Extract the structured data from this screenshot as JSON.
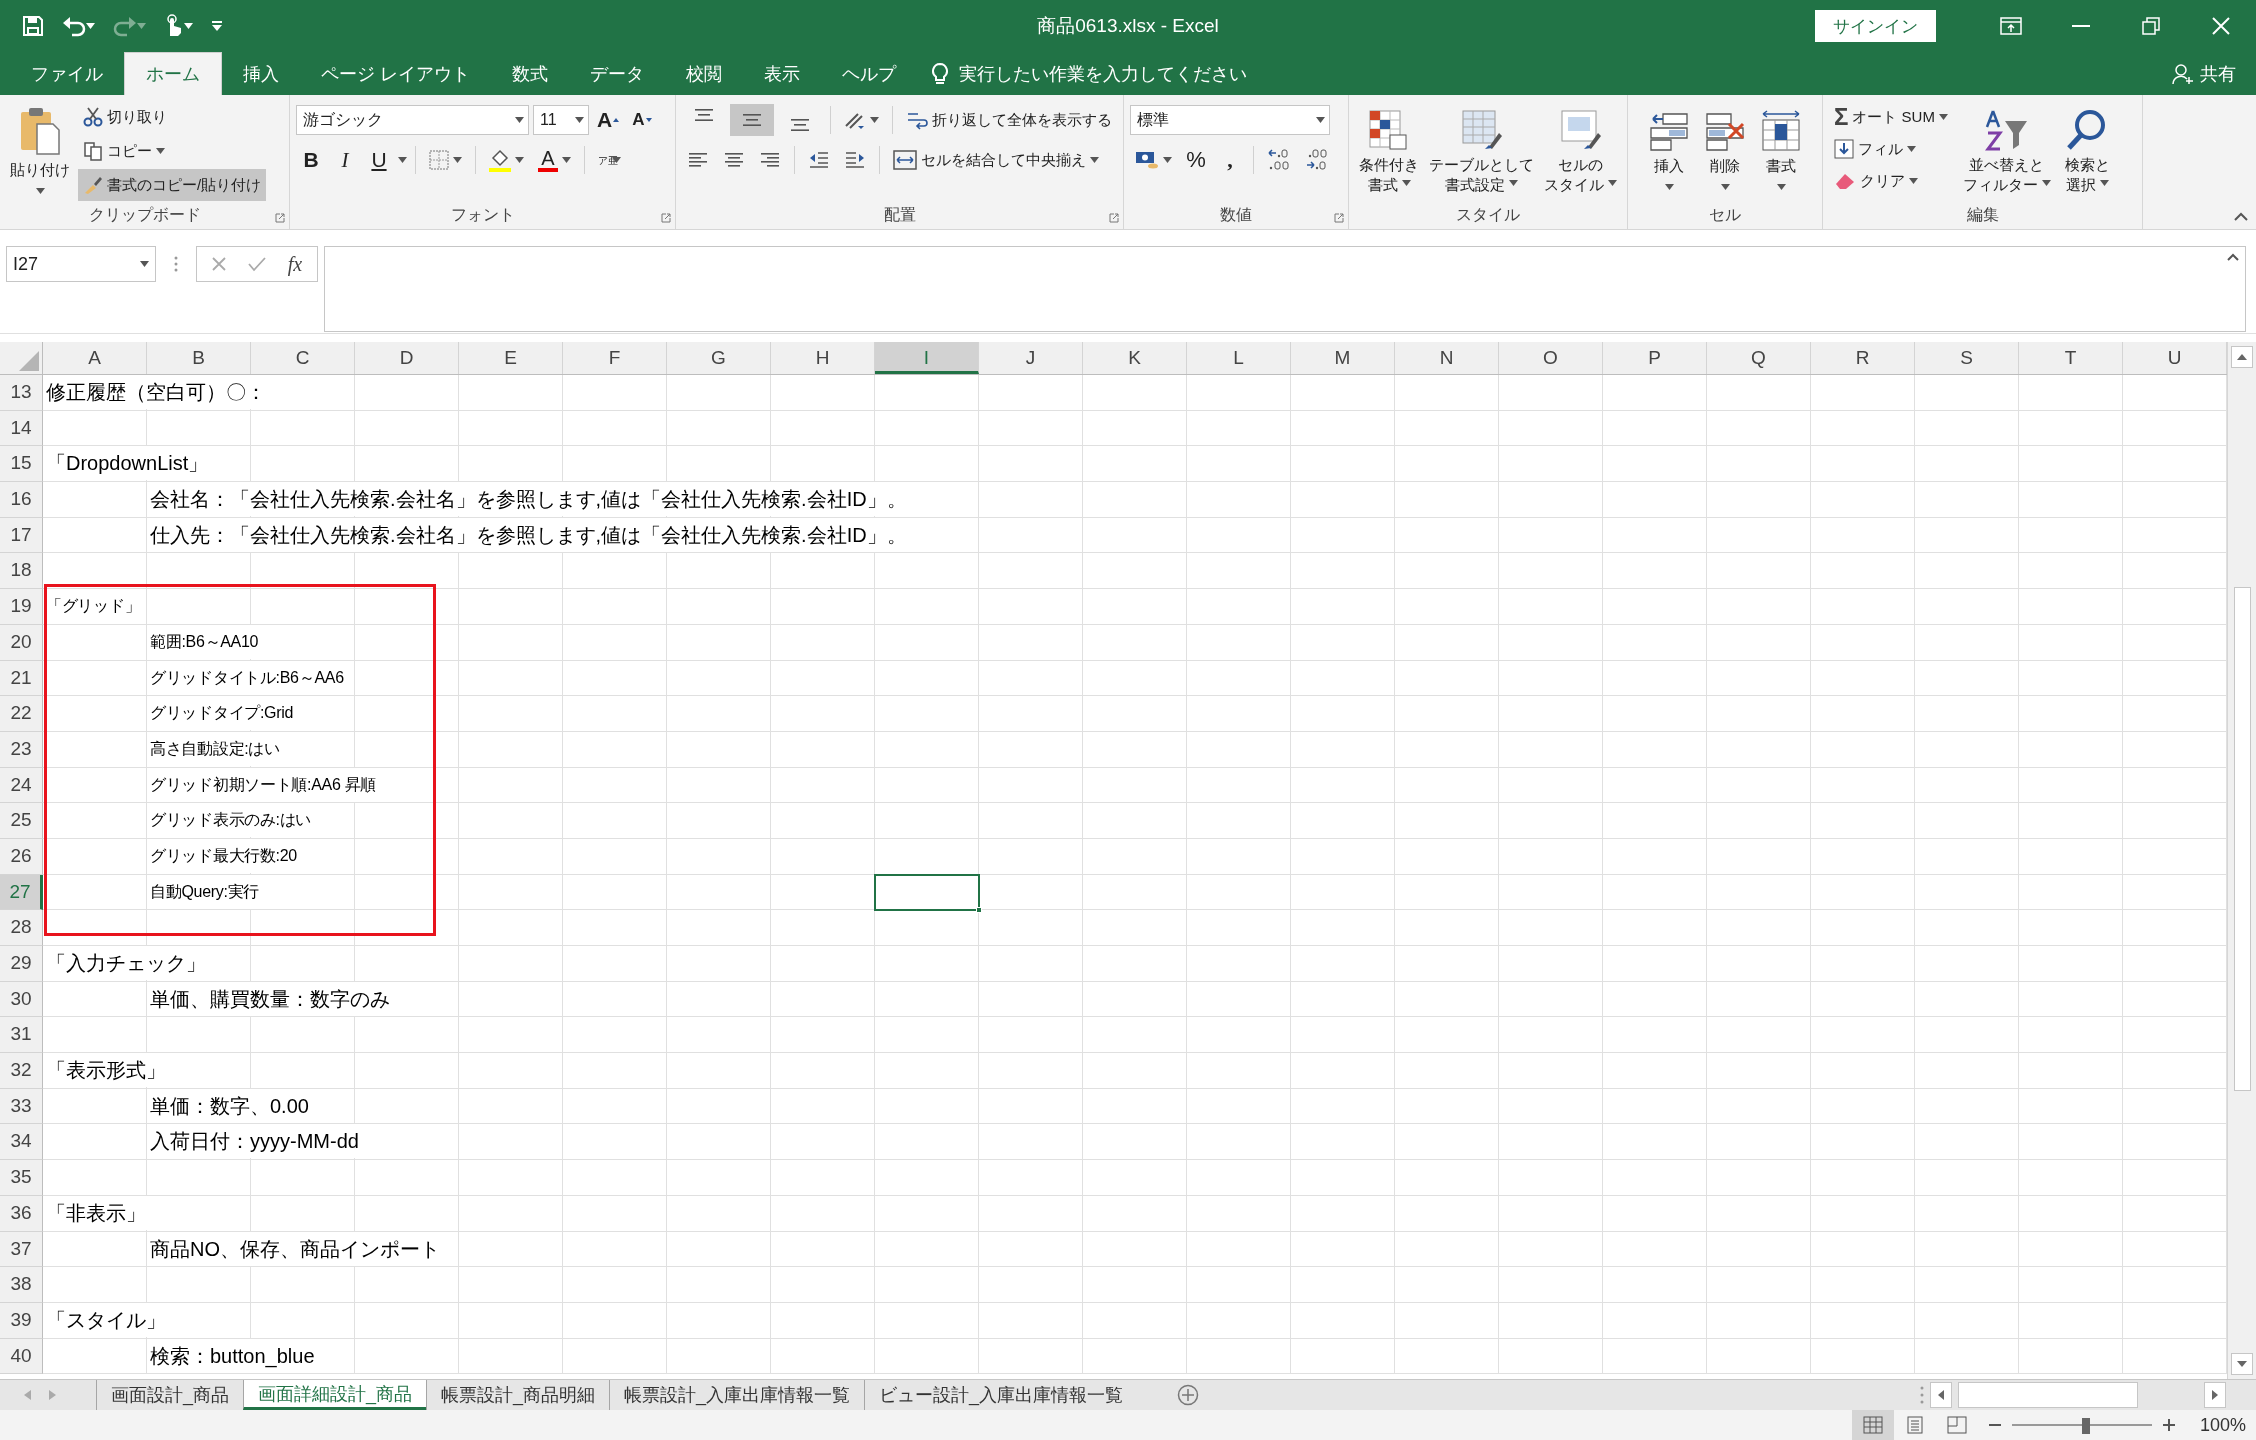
{
  "title_bar": {
    "title": "商品0613.xlsx  -  Excel",
    "sign_in": "サインイン"
  },
  "menu": {
    "tabs": [
      {
        "label": "ファイル",
        "selected": false
      },
      {
        "label": "ホーム",
        "selected": true
      },
      {
        "label": "挿入",
        "selected": false
      },
      {
        "label": "ページ レイアウト",
        "selected": false
      },
      {
        "label": "数式",
        "selected": false
      },
      {
        "label": "データ",
        "selected": false
      },
      {
        "label": "校閲",
        "selected": false
      },
      {
        "label": "表示",
        "selected": false
      },
      {
        "label": "ヘルプ",
        "selected": false
      }
    ],
    "tell_me": "実行したい作業を入力してください",
    "share": "共有"
  },
  "ribbon": {
    "clipboard": {
      "label": "クリップボード",
      "paste": "貼り付け",
      "cut": "切り取り",
      "copy": "コピー",
      "format_painter": {
        "label": "書式のコピー/貼り付け",
        "on": true
      }
    },
    "font": {
      "label": "フォント",
      "font_name": "游ゴシック",
      "font_size": "11",
      "grow": "A",
      "shrink": "A",
      "bold": "B",
      "italic": "I",
      "underline": "U",
      "font_color": "A",
      "phonetic": "ア亜"
    },
    "alignment": {
      "label": "配置",
      "vertical": [
        {
          "kind": "top",
          "on": false
        },
        {
          "kind": "middle",
          "on": true
        },
        {
          "kind": "bottom",
          "on": false
        }
      ],
      "wrap_text": "折り返して全体を表示する",
      "merge": "セルを結合して中央揃え"
    },
    "number": {
      "label": "数値",
      "format": "標準",
      "percent": "%",
      "comma": ","
    },
    "styles": {
      "label": "スタイル",
      "buttons": [
        {
          "kind": "conditional",
          "lines": [
            "条件付き",
            "書式"
          ]
        },
        {
          "kind": "table",
          "lines": [
            "テーブルとして",
            "書式設定"
          ]
        },
        {
          "kind": "cell_style",
          "lines": [
            "セルの",
            "スタイル"
          ]
        }
      ]
    },
    "cells": {
      "label": "セル",
      "buttons": [
        {
          "kind": "insert",
          "label": "挿入"
        },
        {
          "kind": "delete",
          "label": "削除"
        },
        {
          "kind": "format",
          "label": "書式"
        }
      ]
    },
    "editing": {
      "label": "編集",
      "sigma": "Σ",
      "autosum": "オート SUM",
      "fill": "フィル",
      "clear": "クリア",
      "sort": [
        "並べ替えと",
        "フィルター"
      ],
      "find": [
        "検索と",
        "選択"
      ]
    }
  },
  "formula_bar": {
    "name_box": "I27",
    "function_button": "fx"
  },
  "columns": [
    {
      "label": "A",
      "selected": false
    },
    {
      "label": "B",
      "selected": false
    },
    {
      "label": "C",
      "selected": false
    },
    {
      "label": "D",
      "selected": false
    },
    {
      "label": "E",
      "selected": false
    },
    {
      "label": "F",
      "selected": false
    },
    {
      "label": "G",
      "selected": false
    },
    {
      "label": "H",
      "selected": false
    },
    {
      "label": "I",
      "selected": true
    },
    {
      "label": "J",
      "selected": false
    },
    {
      "label": "K",
      "selected": false
    },
    {
      "label": "L",
      "selected": false
    },
    {
      "label": "M",
      "selected": false
    },
    {
      "label": "N",
      "selected": false
    },
    {
      "label": "O",
      "selected": false
    },
    {
      "label": "P",
      "selected": false
    },
    {
      "label": "Q",
      "selected": false
    },
    {
      "label": "R",
      "selected": false
    },
    {
      "label": "S",
      "selected": false
    },
    {
      "label": "T",
      "selected": false
    },
    {
      "label": "U",
      "selected": false
    }
  ],
  "rows": [
    {
      "number": "13",
      "selected": false,
      "boxed": false,
      "cells": [
        {
          "kind": "heading",
          "small": false,
          "text": "修正履歴（空白可）〇："
        }
      ]
    },
    {
      "number": "14",
      "selected": false,
      "boxed": false
    },
    {
      "number": "15",
      "selected": false,
      "boxed": false,
      "cells": [
        {
          "kind": "heading",
          "small": false,
          "text": "「DropdownList」"
        }
      ]
    },
    {
      "number": "16",
      "selected": false,
      "boxed": false,
      "cells": [
        {
          "kind": "item",
          "small": false,
          "text": "会社名：「会社仕入先検索.会社名」を参照します,値は「会社仕入先検索.会社ID」。"
        }
      ]
    },
    {
      "number": "17",
      "selected": false,
      "boxed": false,
      "cells": [
        {
          "kind": "item",
          "small": false,
          "text": "仕入先：「会社仕入先検索.会社名」を参照します,値は「会社仕入先検索.会社ID」。"
        }
      ]
    },
    {
      "number": "18",
      "selected": false,
      "boxed": false
    },
    {
      "number": "19",
      "selected": false,
      "boxed": true,
      "cells": [
        {
          "kind": "heading",
          "small": true,
          "text": "「グリッド」"
        }
      ]
    },
    {
      "number": "20",
      "selected": false,
      "boxed": true,
      "cells": [
        {
          "kind": "item",
          "small": true,
          "text": "範囲:B6～AA10"
        }
      ]
    },
    {
      "number": "21",
      "selected": false,
      "boxed": true,
      "cells": [
        {
          "kind": "item",
          "small": true,
          "text": "グリッドタイトル:B6～AA6"
        }
      ]
    },
    {
      "number": "22",
      "selected": false,
      "boxed": true,
      "cells": [
        {
          "kind": "item",
          "small": true,
          "text": "グリッドタイプ:Grid"
        }
      ]
    },
    {
      "number": "23",
      "selected": false,
      "boxed": true,
      "cells": [
        {
          "kind": "item",
          "small": true,
          "text": "高さ自動設定:はい"
        }
      ]
    },
    {
      "number": "24",
      "selected": false,
      "boxed": true,
      "cells": [
        {
          "kind": "item",
          "small": true,
          "text": "グリッド初期ソート順:AA6 昇順"
        }
      ]
    },
    {
      "number": "25",
      "selected": false,
      "boxed": true,
      "cells": [
        {
          "kind": "item",
          "small": true,
          "text": "グリッド表示のみ:はい"
        }
      ]
    },
    {
      "number": "26",
      "selected": false,
      "boxed": true,
      "cells": [
        {
          "kind": "item",
          "small": true,
          "text": "グリッド最大行数:20"
        }
      ]
    },
    {
      "number": "27",
      "selected": true,
      "boxed": true,
      "cells": [
        {
          "kind": "item",
          "small": true,
          "text": "自動Query:実行"
        }
      ]
    },
    {
      "number": "28",
      "selected": false,
      "boxed": true
    },
    {
      "number": "29",
      "selected": false,
      "boxed": false,
      "cells": [
        {
          "kind": "heading",
          "small": false,
          "text": "「入力チェック」"
        }
      ]
    },
    {
      "number": "30",
      "selected": false,
      "boxed": false,
      "cells": [
        {
          "kind": "item",
          "small": false,
          "text": "単価、購買数量：数字のみ"
        }
      ]
    },
    {
      "number": "31",
      "selected": false,
      "boxed": false
    },
    {
      "number": "32",
      "selected": false,
      "boxed": false,
      "cells": [
        {
          "kind": "heading",
          "small": false,
          "text": "「表示形式」"
        }
      ]
    },
    {
      "number": "33",
      "selected": false,
      "boxed": false,
      "cells": [
        {
          "kind": "item",
          "small": false,
          "text": "単価：数字、0.00"
        }
      ]
    },
    {
      "number": "34",
      "selected": false,
      "boxed": false,
      "cells": [
        {
          "kind": "item",
          "small": false,
          "text": "入荷日付：yyyy-MM-dd"
        }
      ]
    },
    {
      "number": "35",
      "selected": false,
      "boxed": false
    },
    {
      "number": "36",
      "selected": false,
      "boxed": false,
      "cells": [
        {
          "kind": "heading",
          "small": false,
          "text": "「非表示」"
        }
      ]
    },
    {
      "number": "37",
      "selected": false,
      "boxed": false,
      "cells": [
        {
          "kind": "item",
          "small": false,
          "text": "商品NO、保存、商品インポート"
        }
      ]
    },
    {
      "number": "38",
      "selected": false,
      "boxed": false
    },
    {
      "number": "39",
      "selected": false,
      "boxed": false,
      "cells": [
        {
          "kind": "heading",
          "small": false,
          "text": "「スタイル」"
        }
      ]
    },
    {
      "number": "40",
      "selected": false,
      "boxed": false,
      "cells": [
        {
          "kind": "item",
          "small": false,
          "text": "検索：button_blue"
        }
      ]
    }
  ],
  "sheet_tabs": [
    {
      "label": "画面設計_商品",
      "selected": false
    },
    {
      "label": "画面詳細設計_商品",
      "selected": true
    },
    {
      "label": "帳票設計_商品明細",
      "selected": false
    },
    {
      "label": "帳票設計_入庫出庫情報一覧",
      "selected": false
    },
    {
      "label": "ビュー設計_入庫出庫情報一覧",
      "selected": false
    }
  ],
  "status_bar": {
    "views": [
      {
        "kind": "normal",
        "selected": true
      },
      {
        "kind": "page_layout",
        "selected": false
      },
      {
        "kind": "page_break",
        "selected": false
      }
    ],
    "zoom_slider": {
      "level": 0.53
    },
    "zoom": "100%"
  }
}
